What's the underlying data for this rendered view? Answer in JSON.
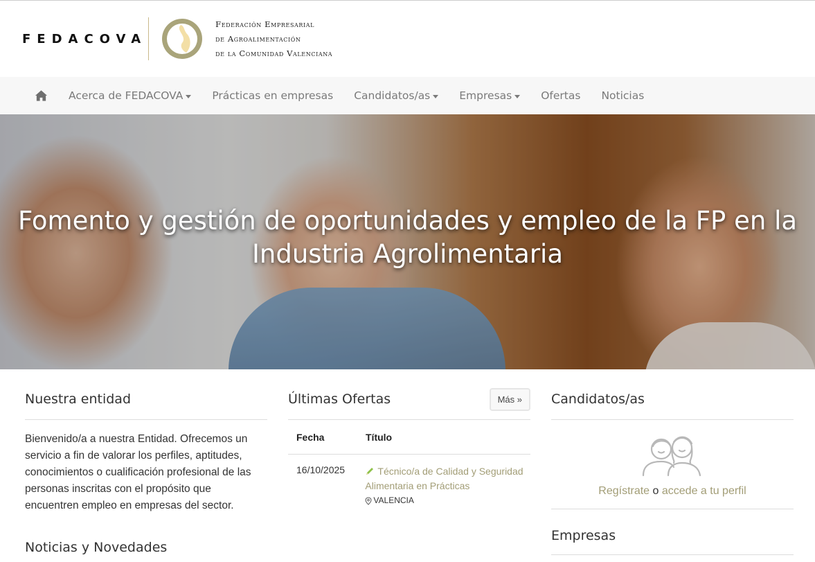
{
  "header": {
    "logo_word": "FEDACOVA",
    "logo_lines": [
      "Federación Empresarial",
      "de Agroalimentación",
      "de la Comunidad Valenciana"
    ]
  },
  "nav": {
    "items": [
      {
        "label": "Acerca de FEDACOVA",
        "dropdown": true
      },
      {
        "label": "Prácticas en empresas",
        "dropdown": false
      },
      {
        "label": "Candidatos/as",
        "dropdown": true
      },
      {
        "label": "Empresas",
        "dropdown": true
      },
      {
        "label": "Ofertas",
        "dropdown": false
      },
      {
        "label": "Noticias",
        "dropdown": false
      }
    ]
  },
  "hero": {
    "title": "Fomento y gestión de oportunidades y empleo de la FP en la Industria Agrolimentaria"
  },
  "entity": {
    "title": "Nuestra entidad",
    "text": "Bienvenido/a a nuestra Entidad. Ofrecemos un servicio a fin de valorar los perfiles, aptitudes, conocimientos o cualificación profesional de las personas inscritas con el propósito que encuentren empleo en empresas del sector.",
    "news_title": "Noticias y Novedades"
  },
  "offers": {
    "title": "Últimas Ofertas",
    "more_label": "Más »",
    "col_date": "Fecha",
    "col_title": "Título",
    "rows": [
      {
        "date": "16/10/2025",
        "title": "Técnico/a de Calidad y Seguridad Alimentaria en Prácticas",
        "location": "VALENCIA"
      }
    ]
  },
  "candidates": {
    "title": "Candidatos/as",
    "register_label": "Regístrate",
    "connector": " o ",
    "profile_label": "accede a tu perfil"
  },
  "companies": {
    "title": "Empresas"
  },
  "colors": {
    "accent": "#a29d76",
    "nav_bg": "#f7f7f7",
    "nav_text": "#7a7a7a"
  }
}
